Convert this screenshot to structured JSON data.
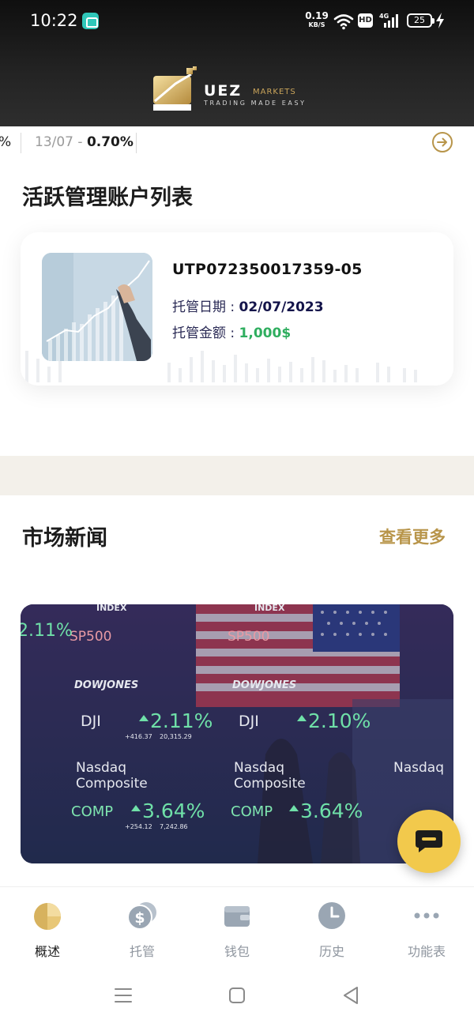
{
  "status_bar": {
    "time": "10:22",
    "net_speed_value": "0.19",
    "net_speed_unit": "KB/S",
    "hd_label": "HD",
    "network_type": "4G",
    "battery_level": "25"
  },
  "brand": {
    "name": "UEZ",
    "suffix": "MARKETS",
    "tagline": "TRADING MADE EASY"
  },
  "ticker": {
    "items": [
      {
        "date": "",
        "value": "%"
      },
      {
        "date": "13/07 - ",
        "value": "0.70%"
      }
    ]
  },
  "accounts": {
    "section_title": "活跃管理账户列表",
    "items": [
      {
        "id": "UTP072350017359-05",
        "date_label": "托管日期 : ",
        "date_value": "02/07/2023",
        "amount_label": "托管金额 : ",
        "amount_value": "1,000$"
      }
    ]
  },
  "news": {
    "section_title": "市场新闻",
    "more_label": "查看更多",
    "image_text": {
      "index": "INDEX",
      "sp": "SP500",
      "dow": "DOWJONES",
      "dji": "DJI",
      "dji_pct": "2.11%",
      "dji_pct2": "2.10%",
      "nasdaq1": "Nasdaq",
      "nasdaq2": "Composite",
      "comp": "COMP",
      "comp_pct": "3.64%",
      "small1": "+416.37",
      "small2": "20,315.29",
      "small3": "+254.12",
      "small4": "7,242.86"
    }
  },
  "tabbar": {
    "tabs": [
      {
        "label": "概述",
        "icon": "pie-chart-icon",
        "active": true
      },
      {
        "label": "托管",
        "icon": "dollar-coins-icon",
        "active": false
      },
      {
        "label": "钱包",
        "icon": "wallet-icon",
        "active": false
      },
      {
        "label": "历史",
        "icon": "clock-icon",
        "active": false
      },
      {
        "label": "功能表",
        "icon": "more-dots-icon",
        "active": false
      }
    ]
  },
  "colors": {
    "accent_gold": "#b8954a",
    "profit_green": "#2fae5f",
    "chat_yellow": "#f2c94c"
  }
}
